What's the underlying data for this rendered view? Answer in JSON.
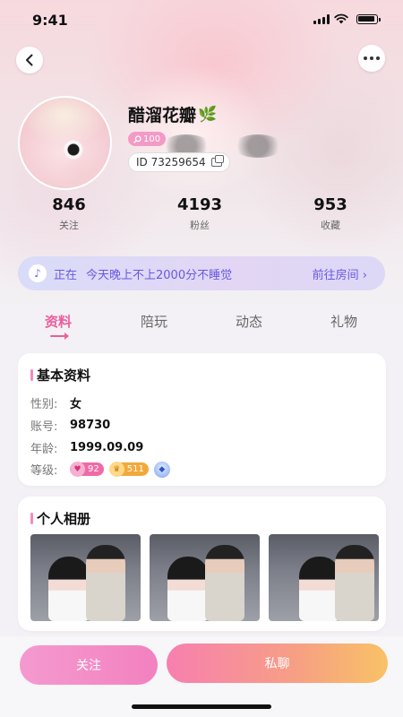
{
  "status_bar": {
    "time": "9:41"
  },
  "profile": {
    "nickname": "醋溜花瓣",
    "badge_value": "100",
    "id_text": "ID 73259654",
    "stats": [
      {
        "value": "846",
        "label": "关注"
      },
      {
        "value": "4193",
        "label": "粉丝"
      },
      {
        "value": "953",
        "label": "收藏"
      }
    ]
  },
  "room": {
    "status": "正在",
    "title": "今天晚上不上2000分不睡觉",
    "action": "前往房间 ›"
  },
  "tabs": [
    {
      "label": "资料"
    },
    {
      "label": "陪玩"
    },
    {
      "label": "动态"
    },
    {
      "label": "礼物"
    }
  ],
  "basic_info": {
    "title": "基本资料",
    "rows": [
      {
        "key": "性别:",
        "value": "女"
      },
      {
        "key": "账号:",
        "value": "98730"
      },
      {
        "key": "年龄:",
        "value": "1999.09.09"
      },
      {
        "key": "等级:"
      }
    ],
    "levels": {
      "charm": "92",
      "wealth": "511"
    }
  },
  "album": {
    "title": "个人相册"
  },
  "actions": {
    "follow": "关注",
    "chat": "私聊"
  },
  "colors": {
    "accent_pink": "#ee5c9d",
    "room_purple": "#6a58e0"
  }
}
